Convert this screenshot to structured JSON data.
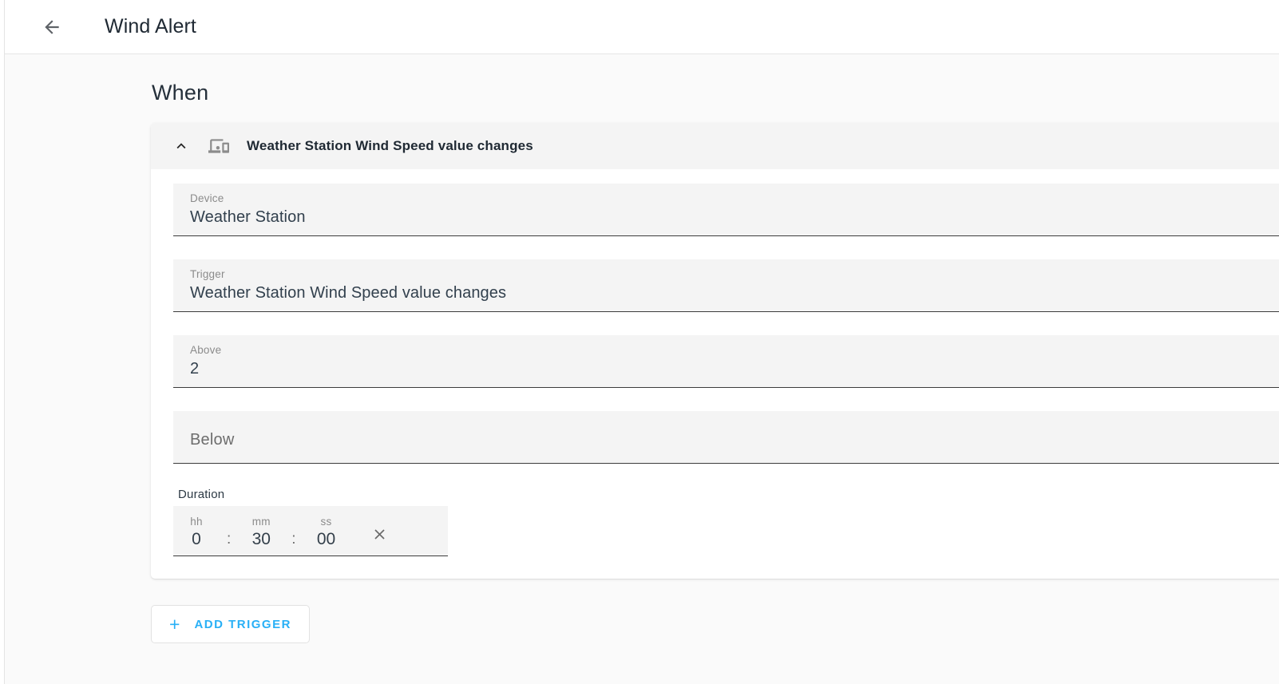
{
  "toolbar": {
    "back_icon": "arrow-back-icon",
    "title": "Wind Alert"
  },
  "main": {
    "section_heading": "When",
    "panel": {
      "expand_icon": "chevron-up-icon",
      "device_icon": "devices-icon",
      "title": "Weather Station Wind Speed value changes",
      "fields": [
        {
          "label": "Device",
          "value": "Weather Station",
          "empty": false
        },
        {
          "label": "Trigger",
          "value": "Weather Station Wind Speed value changes",
          "empty": false
        },
        {
          "label": "Above",
          "value": "2",
          "empty": false
        },
        {
          "label": "Below",
          "value": "",
          "empty": true
        }
      ],
      "duration": {
        "label": "Duration",
        "hours_label": "hh",
        "hours_value": "0",
        "minutes_label": "mm",
        "minutes_value": "30",
        "seconds_label": "ss",
        "seconds_value": "00",
        "separator": ":",
        "clear_icon": "close-icon"
      }
    },
    "add_trigger": {
      "plus": "+",
      "label": "ADD TRIGGER",
      "icon": "plus-icon"
    }
  },
  "colors": {
    "accent": "#29b0f6",
    "page_background": "#fafafa",
    "field_background": "#f4f4f4",
    "panel_header": "#f4f4f4",
    "text_primary": "#1f2933",
    "text_secondary": "#8b8b8b"
  }
}
